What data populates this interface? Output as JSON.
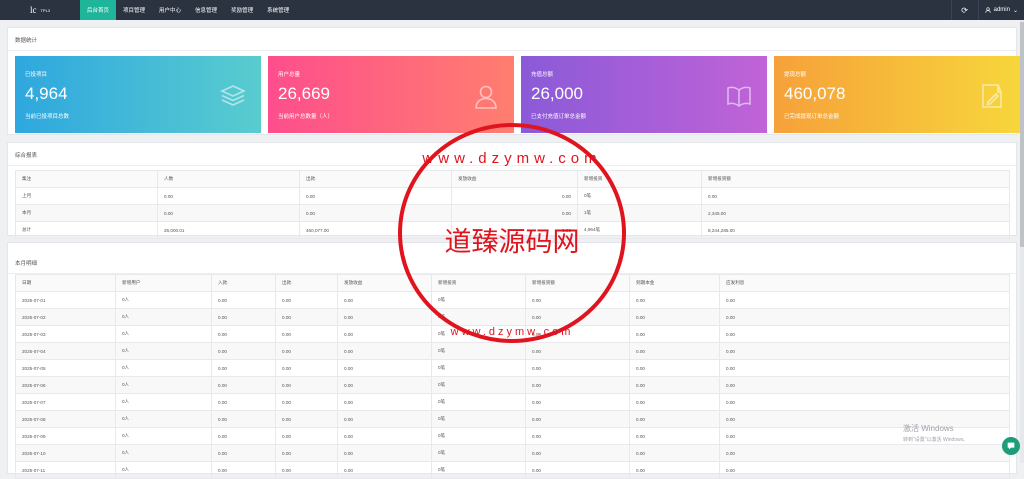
{
  "topbar": {
    "logo_mark": "lc",
    "logo_tag": "TPL3",
    "nav": [
      "后台首页",
      "项目管理",
      "用户中心",
      "信息管理",
      "奖励管理",
      "系统管理"
    ],
    "user": "admin"
  },
  "stats": {
    "title": "数据统计",
    "cards": [
      {
        "label": "已投项目",
        "value": "4,964",
        "desc": "当前已投项目总数",
        "icon": "layers-icon"
      },
      {
        "label": "用户总量",
        "value": "26,669",
        "desc": "当前用户总数量（人）",
        "icon": "user-icon"
      },
      {
        "label": "充值总额",
        "value": "26,000",
        "desc": "已支付充值订单总金额",
        "icon": "book-icon"
      },
      {
        "label": "提现总额",
        "value": "460,078",
        "desc": "已完成提现订单总金额",
        "icon": "edit-icon"
      }
    ]
  },
  "report": {
    "title": "综合报表",
    "headers": [
      "集注",
      "人数",
      "出款",
      "发放收益",
      "新增投资",
      "新增投资额"
    ],
    "rows": [
      [
        "上月",
        "0.00",
        "0.00",
        "0.00",
        "0笔",
        "0.00"
      ],
      [
        "本月",
        "0.00",
        "0.00",
        "0.00",
        "1笔",
        "2,345.00"
      ],
      [
        "总计",
        "26,000.01",
        "460,077.00",
        "0.00",
        "4,964笔",
        "8,244,285.00"
      ]
    ]
  },
  "detail": {
    "title": "本月明细",
    "headers": [
      "日期",
      "新增用户",
      "入款",
      "出款",
      "发放收益",
      "新增投资",
      "新增投资额",
      "到期本金",
      "应发利息"
    ],
    "rows": [
      [
        "2025-07-01",
        "0人",
        "0.00",
        "0.00",
        "0.00",
        "0笔",
        "0.00",
        "0.00",
        "0.00"
      ],
      [
        "2025-07-02",
        "0人",
        "0.00",
        "0.00",
        "0.00",
        "0笔",
        "0.00",
        "0.00",
        "0.00"
      ],
      [
        "2025-07-03",
        "0人",
        "0.00",
        "0.00",
        "0.00",
        "0笔",
        "0.00",
        "0.00",
        "0.00"
      ],
      [
        "2025-07-04",
        "0人",
        "0.00",
        "0.00",
        "0.00",
        "0笔",
        "0.00",
        "0.00",
        "0.00"
      ],
      [
        "2025-07-05",
        "0人",
        "0.00",
        "0.00",
        "0.00",
        "0笔",
        "0.00",
        "0.00",
        "0.00"
      ],
      [
        "2025-07-06",
        "0人",
        "0.00",
        "0.00",
        "0.00",
        "0笔",
        "0.00",
        "0.00",
        "0.00"
      ],
      [
        "2025-07-07",
        "0人",
        "0.00",
        "0.00",
        "0.00",
        "0笔",
        "0.00",
        "0.00",
        "0.00"
      ],
      [
        "2025-07-08",
        "0人",
        "0.00",
        "0.00",
        "0.00",
        "0笔",
        "0.00",
        "0.00",
        "0.00"
      ],
      [
        "2025-07-09",
        "0人",
        "0.00",
        "0.00",
        "0.00",
        "0笔",
        "0.00",
        "0.00",
        "0.00"
      ],
      [
        "2025-07-10",
        "0人",
        "0.00",
        "0.00",
        "0.00",
        "0笔",
        "0.00",
        "0.00",
        "0.00"
      ],
      [
        "2025-07-11",
        "0人",
        "0.00",
        "0.00",
        "0.00",
        "0笔",
        "0.00",
        "0.00",
        "0.00"
      ]
    ]
  },
  "watermark": {
    "text": "道臻源码网",
    "url_top": "www.dzymw.com",
    "url_bottom": "www.dzymw.com"
  },
  "activation": {
    "line1": "激活 Windows",
    "line2": "转到\"设置\"以激活 Windows。"
  },
  "colors": {
    "topbar": "#2b3340",
    "nav_active": "#1fb59a",
    "card1": "#2ea7df",
    "card2": "#fe4e8c",
    "card3": "#8b5ad8",
    "card4": "#f6a13a",
    "watermark": "#e0141e",
    "chat_button": "#1f9c79"
  }
}
